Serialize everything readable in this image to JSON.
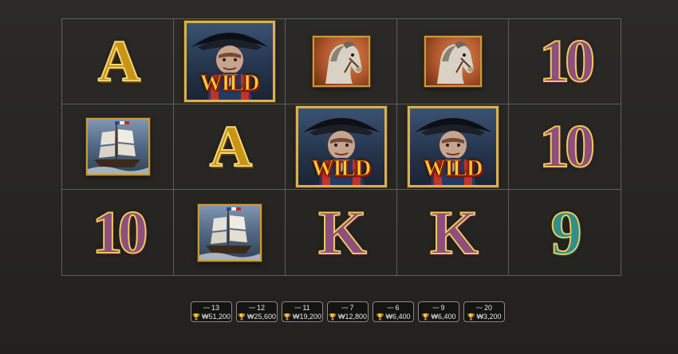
{
  "reels": {
    "wild_label": "WILD",
    "rows": [
      [
        {
          "type": "letter",
          "value": "A",
          "style": "gold"
        },
        {
          "type": "wild",
          "value": "WILD"
        },
        {
          "type": "horse",
          "icon": "horse-icon"
        },
        {
          "type": "horse",
          "icon": "horse-icon"
        },
        {
          "type": "letter",
          "value": "10",
          "style": "purple"
        }
      ],
      [
        {
          "type": "ship",
          "icon": "ship-icon"
        },
        {
          "type": "letter",
          "value": "A",
          "style": "gold"
        },
        {
          "type": "wild",
          "value": "WILD"
        },
        {
          "type": "wild",
          "value": "WILD"
        },
        {
          "type": "letter",
          "value": "10",
          "style": "purple"
        }
      ],
      [
        {
          "type": "letter",
          "value": "10",
          "style": "purple"
        },
        {
          "type": "ship",
          "icon": "ship-icon"
        },
        {
          "type": "letter",
          "value": "K",
          "style": "purple"
        },
        {
          "type": "letter",
          "value": "K",
          "style": "purple"
        },
        {
          "type": "letter",
          "value": "9",
          "style": "teal"
        }
      ]
    ]
  },
  "paylines": [
    {
      "line": "13",
      "prize": "₩51,200"
    },
    {
      "line": "12",
      "prize": "₩25,600"
    },
    {
      "line": "11",
      "prize": "₩19,200"
    },
    {
      "line": "7",
      "prize": "₩12,800"
    },
    {
      "line": "6",
      "prize": "₩6,400"
    },
    {
      "line": "9",
      "prize": "₩6,400"
    },
    {
      "line": "20",
      "prize": "₩3,200"
    }
  ],
  "icons": {
    "line": "payline-icon",
    "prize": "trophy-icon"
  },
  "colors": {
    "gold": "#c99416",
    "purple": "#8d4f7c",
    "teal": "#2f8f8a",
    "wild_text": "#ffcc2e",
    "grid_line": "#5e5d59"
  }
}
